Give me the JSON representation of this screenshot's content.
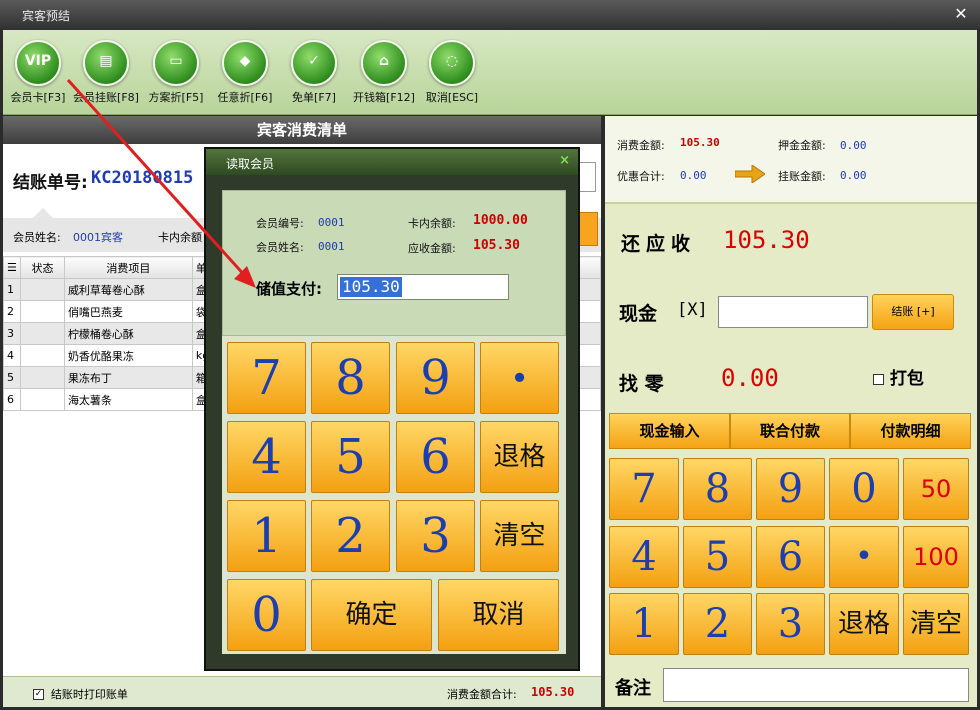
{
  "window": {
    "title": "宾客预结",
    "close": "✕"
  },
  "toolbar": [
    {
      "label": "会员卡[F3]",
      "glyph": "VIP"
    },
    {
      "label": "会员挂账[F8]",
      "glyph": "▤"
    },
    {
      "label": "方案折[F5]",
      "glyph": "▭"
    },
    {
      "label": "任意折[F6]",
      "glyph": "◆"
    },
    {
      "label": "免单[F7]",
      "glyph": "✓"
    },
    {
      "label": "开钱箱[F12]",
      "glyph": "⌂"
    },
    {
      "label": "取消[ESC]",
      "glyph": "◌"
    }
  ],
  "left": {
    "header": "宾客消费清单",
    "bill_label": "结账单号:",
    "bill_no": "KC20180815",
    "member_name_label": "会员姓名:",
    "member_name_value": "0001宾客",
    "card_balance_label": "卡内余额",
    "columns": [
      "☰",
      "状态",
      "消费项目",
      "单"
    ],
    "rows": [
      {
        "no": "1",
        "item": "威利草莓卷心酥",
        "unit": "盒"
      },
      {
        "no": "2",
        "item": "俏嘴巴燕麦",
        "unit": "袋"
      },
      {
        "no": "3",
        "item": "柠檬桶卷心酥",
        "unit": "盒"
      },
      {
        "no": "4",
        "item": "奶香优酪果冻",
        "unit": "kg"
      },
      {
        "no": "5",
        "item": "果冻布丁",
        "unit": "箱"
      },
      {
        "no": "6",
        "item": "海太薯条",
        "unit": "盒"
      }
    ],
    "print_on_settle": "结账时打印账单",
    "total_label": "消费金额合计:",
    "total_value": "105.30"
  },
  "right": {
    "consume_label": "消费金额:",
    "consume_value": "105.30",
    "deposit_label": "押金金额:",
    "deposit_value": "0.00",
    "discount_label": "优惠合计:",
    "discount_value": "0.00",
    "onaccount_label": "挂账金额:",
    "onaccount_value": "0.00",
    "due_label": "还应收",
    "due_value": "105.30",
    "cash_label": "现金",
    "cash_key": "[X]",
    "settle_label": "结账 [+]",
    "change_label": "找  零",
    "change_value": "0.00",
    "pack_label": "打包",
    "tabs": [
      "现金输入",
      "联合付款",
      "付款明细"
    ],
    "keypad": [
      "7",
      "8",
      "9",
      "0",
      "50",
      "4",
      "5",
      "6",
      "•",
      "100",
      "1",
      "2",
      "3",
      "退格",
      "清空"
    ],
    "remark_label": "备注"
  },
  "dialog": {
    "title": "读取会员",
    "close": "×",
    "member_no_label": "会员编号:",
    "member_no_value": "0001",
    "member_name_label": "会员姓名:",
    "member_name_value": "0001",
    "balance_label": "卡内余额:",
    "balance_value": "1000.00",
    "receivable_label": "应收金额:",
    "receivable_value": "105.30",
    "pay_label": "储值支付:",
    "pay_value": "105.30",
    "keypad": [
      "7",
      "8",
      "9",
      "•",
      "4",
      "5",
      "6",
      "退格",
      "1",
      "2",
      "3",
      "清空",
      "0",
      "确定",
      "取消"
    ]
  }
}
